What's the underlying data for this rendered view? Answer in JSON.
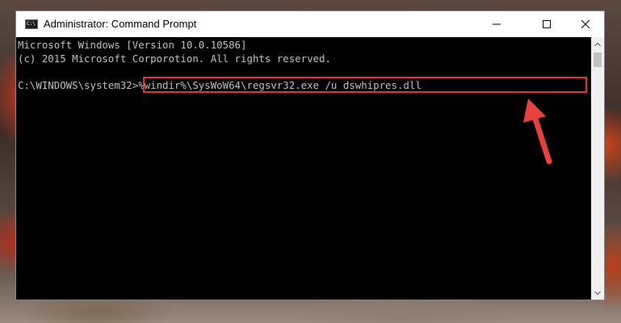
{
  "window": {
    "title": "Administrator: Command Prompt",
    "icon_name": "cmd-icon",
    "icon_text": "C:\\"
  },
  "controls": {
    "minimize_icon": "minimize-icon",
    "maximize_icon": "maximize-icon",
    "close_icon": "close-icon"
  },
  "console": {
    "line1": "Microsoft Windows [Version 10.0.10586]",
    "line2": "(c) 2015 Microsoft Corporotion. All rights reserved.",
    "prompt": "C:\\WINDOWS\\system32>",
    "command": "%windir%\\SysWoW64\\regsvr32.exe /u dswhipres.dll"
  },
  "highlight": {
    "box_color": "#e0333a",
    "arrow_color": "#e8413c"
  },
  "colors": {
    "console_bg": "#000000",
    "console_text": "#c0c0c0"
  }
}
